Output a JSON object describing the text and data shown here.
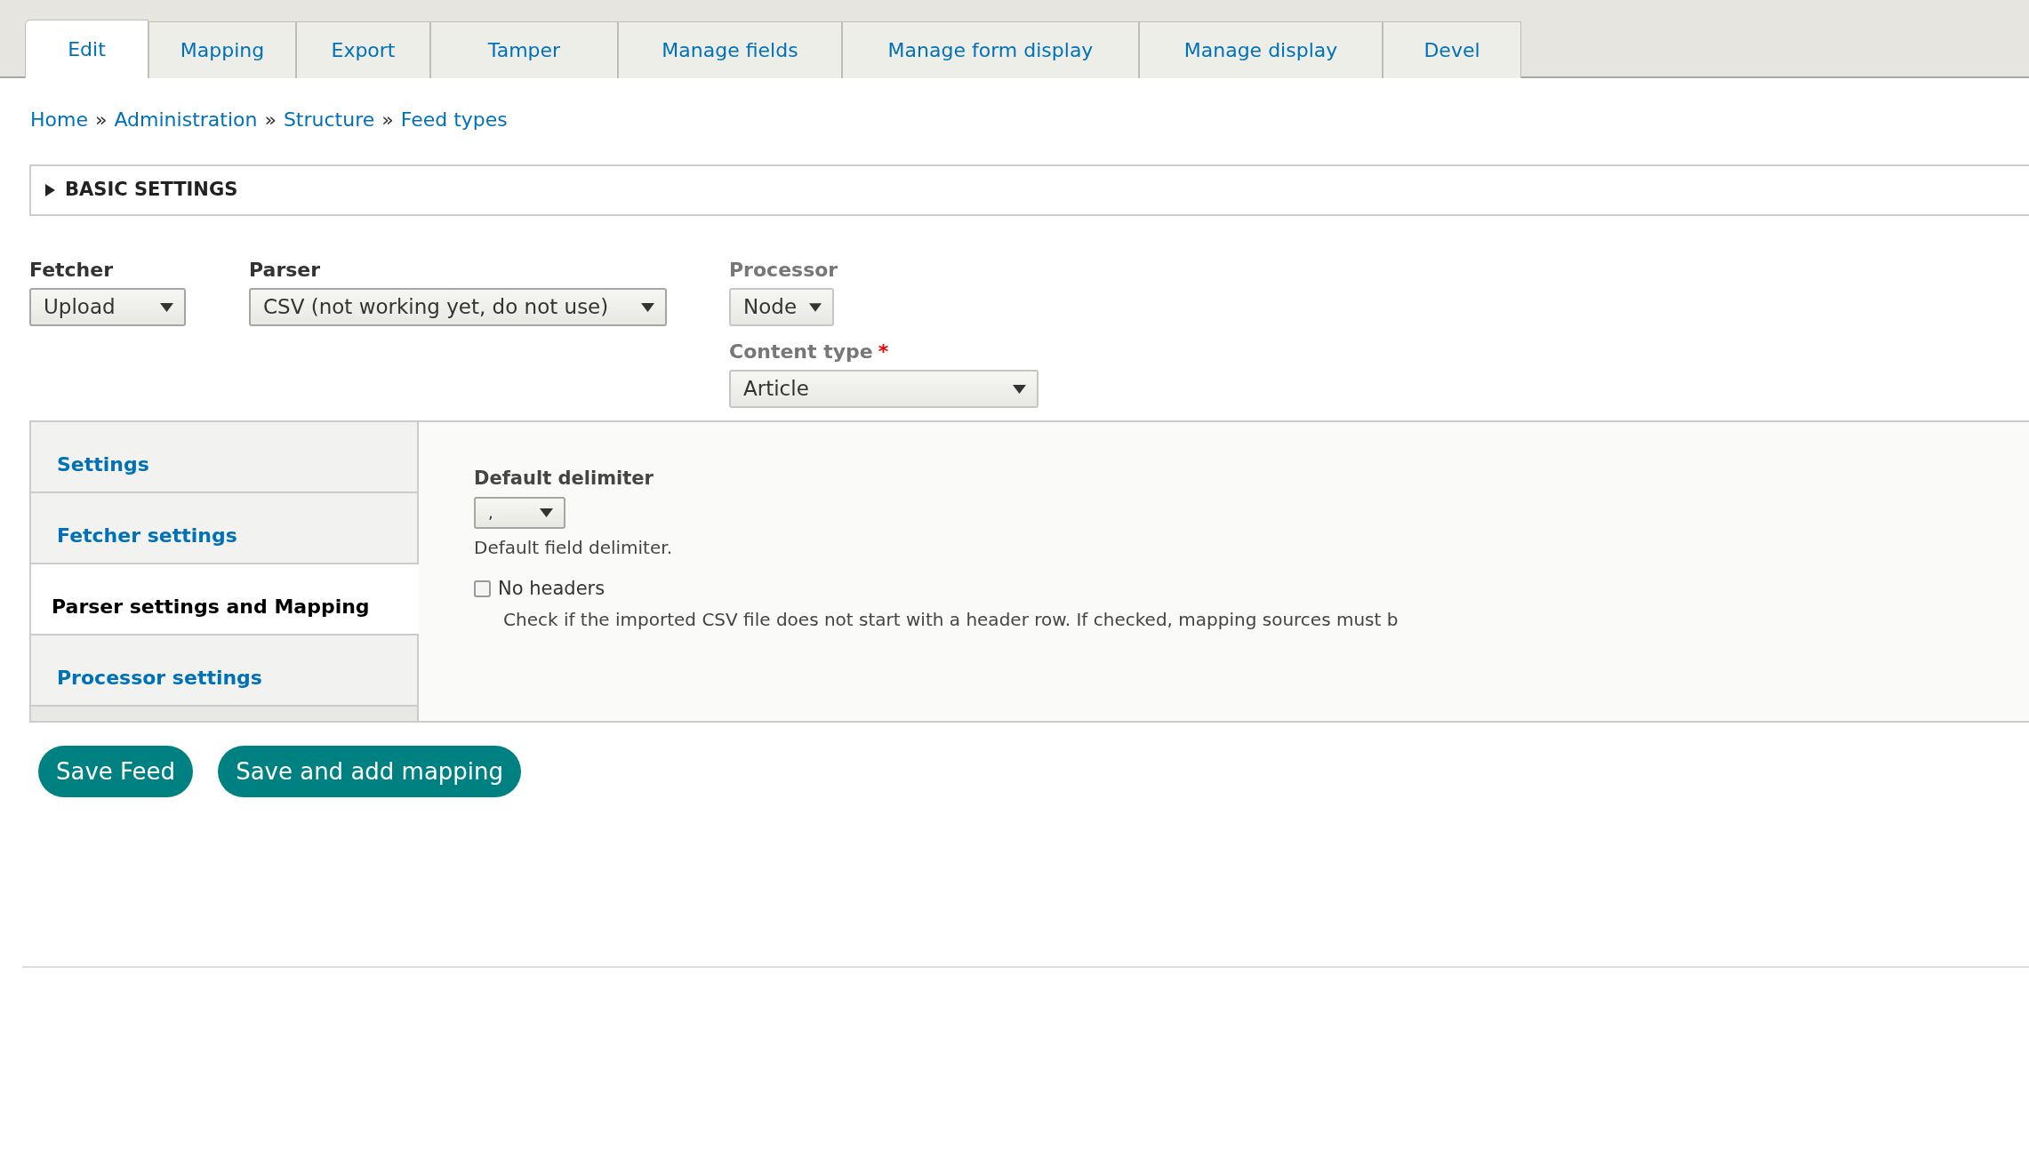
{
  "tabs": [
    {
      "label": "Edit",
      "selected": true
    },
    {
      "label": "Mapping",
      "selected": false
    },
    {
      "label": "Export",
      "selected": false
    },
    {
      "label": "Tamper",
      "selected": false
    },
    {
      "label": "Manage fields",
      "selected": false
    },
    {
      "label": "Manage form display",
      "selected": false
    },
    {
      "label": "Manage display",
      "selected": false
    },
    {
      "label": "Devel",
      "selected": false
    }
  ],
  "breadcrumb": [
    "Home",
    "Administration",
    "Structure",
    "Feed types"
  ],
  "breadcrumb_separator": "»",
  "basic_settings": {
    "title": "BASIC SETTINGS",
    "expanded": false
  },
  "plugins": [
    {
      "label": "Fetcher",
      "value": "Upload",
      "disabled": false
    },
    {
      "label": "Parser",
      "value": "CSV (not working yet, do not use)",
      "disabled": false
    },
    {
      "label": "Processor",
      "value": "Node",
      "disabled": true
    },
    {
      "label": "Content type",
      "value": "Article",
      "disabled": true,
      "required_mark": "*"
    }
  ],
  "vertical_tabs": [
    {
      "label": "Settings",
      "selected": false
    },
    {
      "label": "Fetcher settings",
      "selected": false
    },
    {
      "label": "Parser settings and Mapping",
      "selected": true
    },
    {
      "label": "Processor settings",
      "selected": false
    }
  ],
  "parser_settings": {
    "delimiter_label": "Default delimiter",
    "delimiter_value": ",",
    "delimiter_description": "Default field delimiter.",
    "no_headers": {
      "label": "No headers",
      "checked": false,
      "description": "Check if the imported CSV file does not start with a header row. If checked, mapping sources must b"
    }
  },
  "buttons": [
    "Save Feed",
    "Save and add mapping"
  ]
}
